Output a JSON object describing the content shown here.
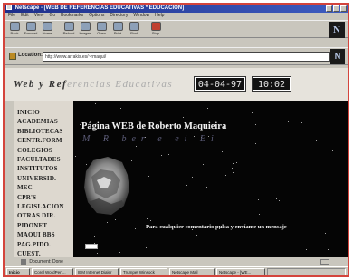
{
  "window": {
    "title": "Netscape - [WEB DE REFERENCIAS EDUCATIVAS * EDUCACION]"
  },
  "menu": [
    "File",
    "Edit",
    "View",
    "Go",
    "Bookmarks",
    "Options",
    "Directory",
    "Window",
    "Help"
  ],
  "toolbar": {
    "buttons": [
      "Back",
      "Forward",
      "Home",
      "Reload",
      "Images",
      "Open",
      "Print",
      "Find",
      "Stop"
    ]
  },
  "location": {
    "label": "Location:",
    "url": "http://www.arrakis.es/~rmaqui/"
  },
  "banner": {
    "title_dark": "Web y Ref",
    "title_light": "erencias Educativas",
    "date": "04-04-97",
    "time": "10:02"
  },
  "sidebar": {
    "items": [
      "INICIO",
      "ACADEMIAS",
      "BIBLIOTECAS",
      "CENTR.FORM",
      "COLEGIOS",
      "FACULTADES",
      "INSTITUTOS",
      "UNIVERSID.",
      "MEC",
      "CPR'S",
      "LEGISLACION",
      "OTRAS DIR.",
      "PIDONET",
      "MAQUI BBS",
      "PAG.PIDO.",
      "CUEST."
    ]
  },
  "main": {
    "heading": "Página WEB de Roberto Maquieira",
    "script_text": "M   R ber e ei  Ei",
    "footer": "Para cualquier comentario pulsa y envíame un mensaje"
  },
  "status": {
    "text": "Document: Done"
  },
  "taskbar": {
    "items": [
      "Inicio",
      "Corel WordPerf...",
      "IBM Internet Dialer",
      "Trumpet Winsock",
      "Netscape Mail",
      "Netscape - [WE..."
    ]
  }
}
